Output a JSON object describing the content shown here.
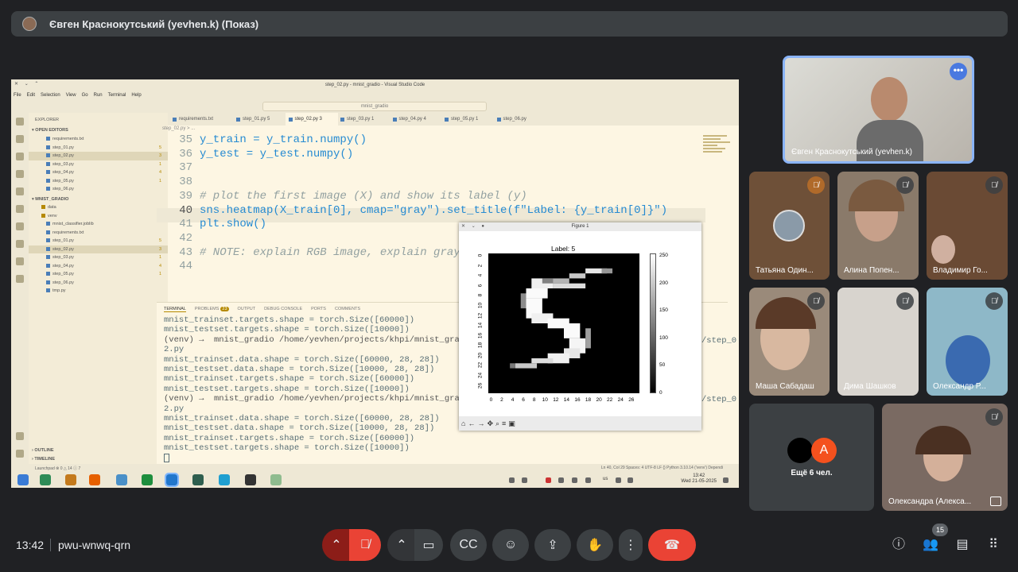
{
  "presenter_bar": {
    "text": "Євген Краснокутський (yevhen.k) (Показ)"
  },
  "vscode": {
    "window_title": "step_02.py - mnist_gradio - Visual Studio Code",
    "menu": [
      "File",
      "Edit",
      "Selection",
      "View",
      "Go",
      "Run",
      "Terminal",
      "Help"
    ],
    "command_center": "mnist_gradio",
    "explorer_title": "EXPLORER",
    "open_editors_title": "OPEN EDITORS",
    "open_editors": [
      {
        "name": "requirements.txt",
        "badge": ""
      },
      {
        "name": "step_01.py",
        "badge": "5"
      },
      {
        "name": "step_02.py",
        "badge": "3"
      },
      {
        "name": "step_03.py",
        "badge": "1"
      },
      {
        "name": "step_04.py",
        "badge": "4"
      },
      {
        "name": "step_05.py",
        "badge": "1"
      },
      {
        "name": "step_06.py",
        "badge": ""
      }
    ],
    "project_title": "MNIST_GRADIO",
    "project_files": [
      {
        "name": "data",
        "badge": ""
      },
      {
        "name": "venv",
        "badge": ""
      },
      {
        "name": "mnist_classifier.joblib",
        "badge": ""
      },
      {
        "name": "requirements.txt",
        "badge": ""
      },
      {
        "name": "step_01.py",
        "badge": "5"
      },
      {
        "name": "step_02.py",
        "badge": "3"
      },
      {
        "name": "step_03.py",
        "badge": "1"
      },
      {
        "name": "step_04.py",
        "badge": "4"
      },
      {
        "name": "step_05.py",
        "badge": "1"
      },
      {
        "name": "step_06.py",
        "badge": ""
      },
      {
        "name": "tmp.py",
        "badge": ""
      }
    ],
    "outline_title": "OUTLINE",
    "timeline_title": "TIMELINE",
    "tabs": [
      "requirements.txt",
      "step_01.py 5",
      "step_02.py 3",
      "step_03.py 1",
      "step_04.py 4",
      "step_05.py 1",
      "step_06.py"
    ],
    "breadcrumb": "step_02.py > ...",
    "code_lines": [
      {
        "num": "35",
        "text": "y_train = y_train.numpy()"
      },
      {
        "num": "36",
        "text": "y_test = y_test.numpy()"
      },
      {
        "num": "37",
        "text": ""
      },
      {
        "num": "38",
        "text": ""
      },
      {
        "num": "39",
        "text": "# plot the first image (X) and show its label (y)"
      },
      {
        "num": "40",
        "text": "sns.heatmap(X_train[0], cmap=\"gray\").set_title(f\"Label: {y_train[0]}\")"
      },
      {
        "num": "41",
        "text": "plt.show()"
      },
      {
        "num": "42",
        "text": ""
      },
      {
        "num": "43",
        "text": "# NOTE: explain RGB image, explain grays"
      },
      {
        "num": "44",
        "text": ""
      }
    ],
    "panel_tabs": [
      "TERMINAL",
      "PROBLEMS",
      "OUTPUT",
      "DEBUG CONSOLE",
      "PORTS",
      "COMMENTS"
    ],
    "problems_count": "23",
    "terminal_lines": [
      "mnist_trainset.targets.shape = torch.Size([60000])",
      "mnist_testset.targets.shape = torch.Size([10000])",
      "(venv) →  mnist_gradio /home/yevhen/projects/khpi/mnist_gradio/ve",
      "2.py",
      "mnist_trainset.data.shape = torch.Size([60000, 28, 28])",
      "mnist_testset.data.shape = torch.Size([10000, 28, 28])",
      "mnist_trainset.targets.shape = torch.Size([60000])",
      "mnist_testset.targets.shape = torch.Size([10000])",
      "(venv) →  mnist_gradio /home/yevhen/projects/khpi/mnist_gradio/ve",
      "2.py",
      "mnist_trainset.data.shape = torch.Size([60000, 28, 28])",
      "mnist_testset.data.shape = torch.Size([10000, 28, 28])",
      "mnist_trainset.targets.shape = torch.Size([60000])",
      "mnist_testset.targets.shape = torch.Size([10000])"
    ],
    "terminal_suffix": "/step_0",
    "status_left": "Launchpad  ⊗ 0 △ 14 ⓘ 7",
    "status_right": "Ln 40, Col 29   Spaces: 4   UTF-8   LF   {} Python   3.10.14 ('venv')   Dependi",
    "clock_time": "13:42",
    "clock_date": "Wed 21-05-2025",
    "tray_lang": "us"
  },
  "figure": {
    "title": "Figure 1",
    "chart_data": {
      "type": "heatmap",
      "title": "Label: 5",
      "rows": 28,
      "cols": 28,
      "x_ticks": [
        "0",
        "2",
        "4",
        "6",
        "8",
        "10",
        "12",
        "14",
        "16",
        "18",
        "20",
        "22",
        "24",
        "26"
      ],
      "y_ticks": [
        "0",
        "2",
        "4",
        "6",
        "8",
        "10",
        "12",
        "14",
        "16",
        "18",
        "20",
        "22",
        "24",
        "26"
      ],
      "colorbar_ticks": [
        "250",
        "200",
        "150",
        "100",
        "50",
        "0"
      ],
      "colormap": "gray",
      "value_range": [
        0,
        255
      ]
    },
    "toolbar_icons": [
      "home-icon",
      "back-icon",
      "forward-icon",
      "pan-icon",
      "zoom-icon",
      "configure-icon",
      "save-icon"
    ]
  },
  "participants": [
    {
      "name": "Євген Краснокутський (yevhen.k)",
      "muted": false
    },
    {
      "name": "Татьяна Один...",
      "muted": true
    },
    {
      "name": "Алина Попен...",
      "muted": true
    },
    {
      "name": "Владимир Го...",
      "muted": true
    },
    {
      "name": "Маша Сабадаш",
      "muted": true
    },
    {
      "name": "Дима Шашков",
      "muted": true
    },
    {
      "name": "Олександр Р...",
      "muted": true
    },
    {
      "name": "Олександра (Алекса...",
      "muted": true
    }
  ],
  "others_tile": {
    "avatar_letter": "A",
    "label": "Ещё 6 чел."
  },
  "bottom_bar": {
    "time": "13:42",
    "meeting_code": "pwu-wnwq-qrn",
    "participant_count": "15"
  },
  "colors": {
    "accent": "#8ab4f8",
    "end_call": "#ea4335",
    "more_button": "#4a79e0",
    "avatar_orange": "#f4511e"
  }
}
